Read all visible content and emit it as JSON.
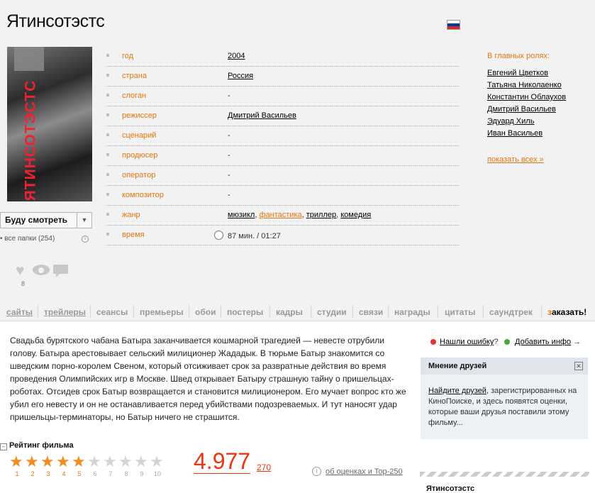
{
  "title": "Ятинсотэстс",
  "flag": {
    "name": "russian-flag",
    "colors": [
      "#ffffff",
      "#0039a6",
      "#d52b1e"
    ]
  },
  "poster": {
    "text": "ЯТИНСОТЭСТС"
  },
  "watch_button": {
    "label": "Буду смотреть"
  },
  "folders_text": "все папки (254)",
  "info_rows": [
    {
      "key": "год",
      "value": "2004"
    },
    {
      "key": "страна",
      "value": "Россия"
    },
    {
      "key": "слоган",
      "value": "-"
    },
    {
      "key": "режиссер",
      "value": "Дмитрий Васильев"
    },
    {
      "key": "сценарий",
      "value": "-"
    },
    {
      "key": "продюсер",
      "value": "-"
    },
    {
      "key": "оператор",
      "value": "-"
    },
    {
      "key": "композитор",
      "value": "-"
    },
    {
      "key": "жанр",
      "genres": [
        "мюзикл",
        "фантастика",
        "триллер",
        "комедия"
      ],
      "sep": ", "
    },
    {
      "key": "время",
      "value": "87 мин. / 01:27"
    }
  ],
  "cast": {
    "heading": "В главных ролях:",
    "actors": [
      "Евгений Цветков",
      "Татьяна Николаенко",
      "Константин Облаухов",
      "Дмитрий Васильев",
      "Эдуард Хиль",
      "Иван Васильев"
    ],
    "show_all": "показать всех",
    "show_all_arrow": "»"
  },
  "favorites_count": "8",
  "tabs": [
    "сайты",
    "трейлеры",
    "сеансы",
    "премьеры",
    "обои",
    "постеры",
    "кадры",
    "студии",
    "связи",
    "награды",
    "цитаты",
    "саундтрек"
  ],
  "tab_order": {
    "first": "з",
    "rest": "аказать!"
  },
  "description": "Свадьба бурятского чабана Батыра заканчивается кошмарной трагедией — невесте отрубили голову. Батыра арестовывает сельский милиционер Жададык. В тюрьме Батыр знакомится со шведским порно-королем Свеном, который отсиживает срок за развратные действия во время проведения Олимпийских игр в Москве. Швед открывает Батыру страшную тайну о пришельцах-роботах. Отсидев срок Батыр возвращается и становится милиционером. Его мучает вопрос кто же убил его невесту и он не останавливается перед убийствами подозреваемых. И тут наносят удар пришельцы-терминаторы, но Батыр ничего не страшится.",
  "rating": {
    "heading": "Рейтинг фильма",
    "score": "4.977",
    "votes": "270",
    "stars_filled": 5,
    "star_numbers": [
      "1",
      "2",
      "3",
      "4",
      "5",
      "6",
      "7",
      "8",
      "9",
      "10"
    ],
    "about_link": "об оценках и Top-250",
    "star_color": "#f28a1c"
  },
  "side": {
    "error_link": "Нашли ошибку",
    "error_q": "?",
    "add_link": "Добавить инфо",
    "add_arrow": "→",
    "friends_title": "Мнение друзей",
    "friends_close": "✕",
    "friends_link": "Найдите друзей",
    "friends_text": ", зарегистрированных на КиноПоиске, и здесь появятся оценки, которые ваши друзья поставили этому фильму...",
    "bottom_title": "Ятинсотэстс"
  }
}
